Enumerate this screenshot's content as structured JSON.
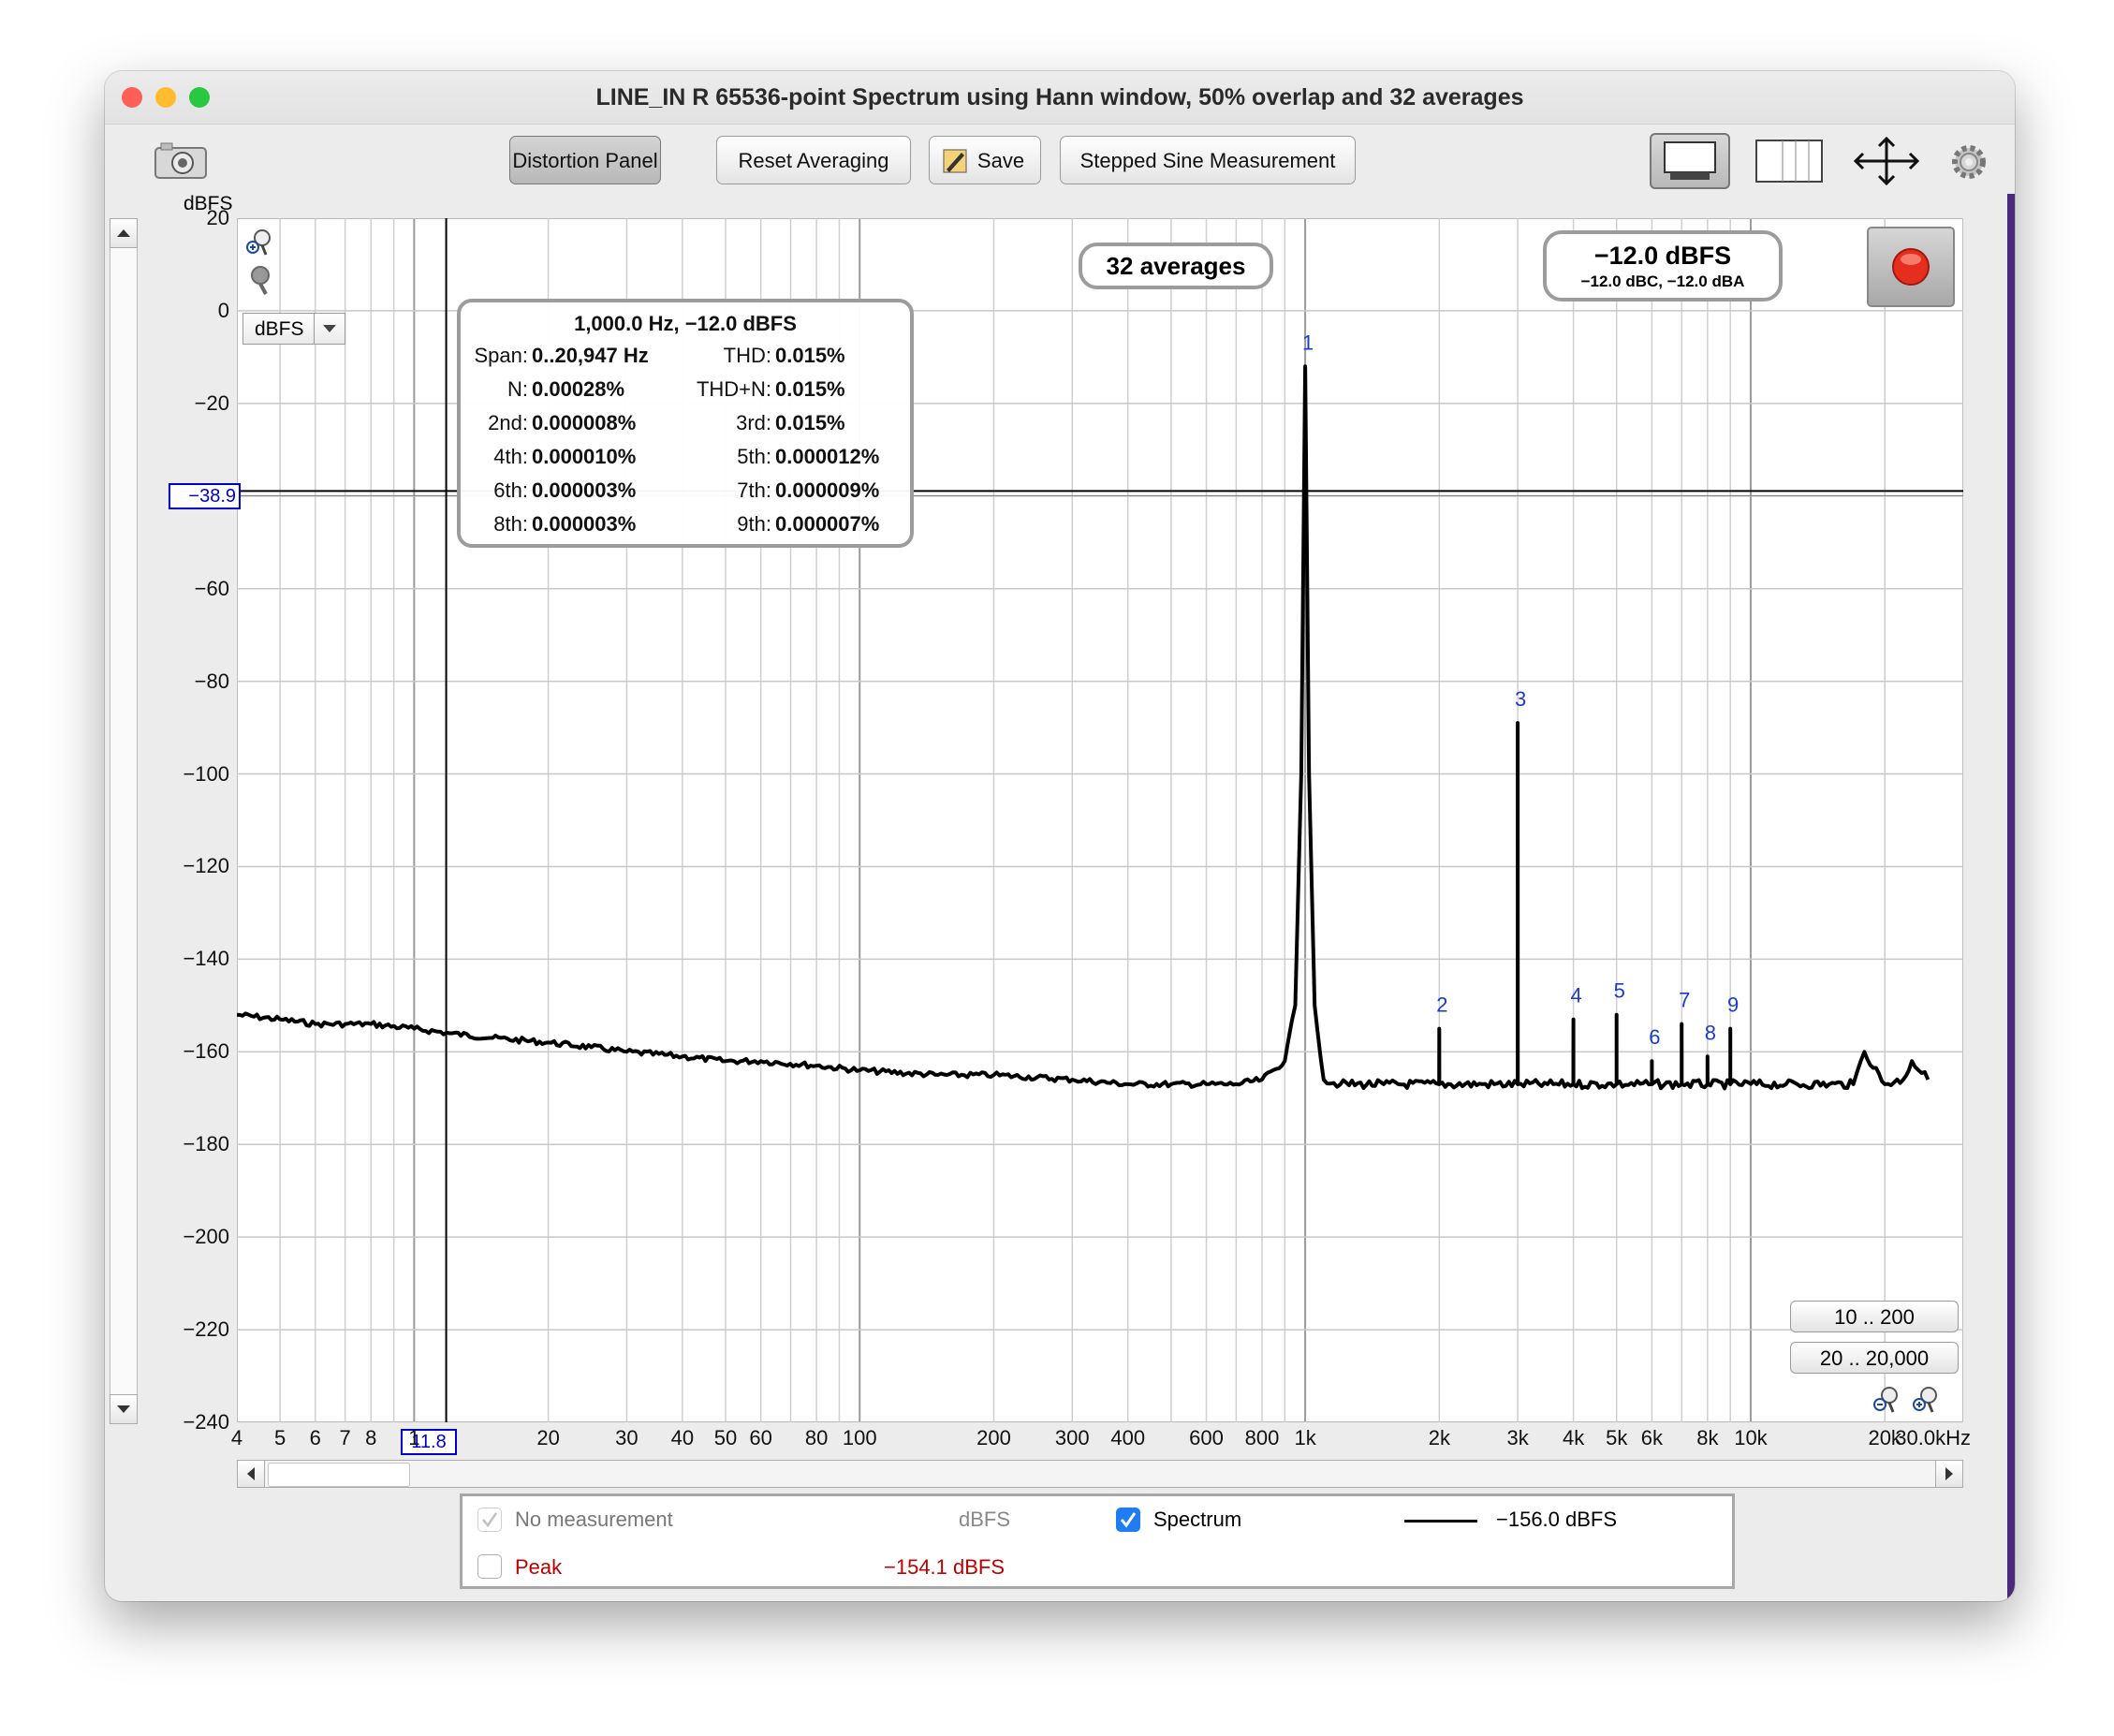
{
  "window": {
    "title": "LINE_IN R 65536-point Spectrum using Hann window, 50% overlap and 32 averages",
    "traffic_lights": {
      "close": "#ff5f57",
      "minimize": "#febc2e",
      "zoom": "#28c840"
    }
  },
  "toolbar": {
    "camera_icon": "camera-icon",
    "distortion_panel": "Distortion Panel",
    "reset_averaging": "Reset Averaging",
    "save": "Save",
    "stepped_sine": "Stepped Sine Measurement",
    "view_icons": [
      "screen-layout-icon",
      "columns-icon",
      "expand-arrows-icon",
      "gear-icon"
    ]
  },
  "distortion_panel": {
    "header": "1,000.0 Hz, −12.0 dBFS",
    "rows": [
      {
        "l1": "Span:",
        "v1": "0..20,947 Hz",
        "l2": "THD:",
        "v2": "0.015%"
      },
      {
        "l1": "N:",
        "v1": "0.00028%",
        "l2": "THD+N:",
        "v2": "0.015%"
      },
      {
        "l1": "2nd:",
        "v1": "0.000008%",
        "l2": "3rd:",
        "v2": "0.015%"
      },
      {
        "l1": "4th:",
        "v1": "0.000010%",
        "l2": "5th:",
        "v2": "0.000012%"
      },
      {
        "l1": "6th:",
        "v1": "0.000003%",
        "l2": "7th:",
        "v2": "0.000009%"
      },
      {
        "l1": "8th:",
        "v1": "0.000003%",
        "l2": "9th:",
        "v2": "0.000007%"
      }
    ]
  },
  "averages_badge": "32 averages",
  "level_display": {
    "main": "−12.0 dBFS",
    "sub": "−12.0 dBC, −12.0 dBA"
  },
  "unit_select": "dBFS",
  "y_unit_label": "dBFS",
  "cursor": {
    "y_value": "−38.9",
    "x_value": "11.8"
  },
  "range_buttons": [
    "10 .. 200",
    "20 .. 20,000"
  ],
  "legend": {
    "no_measurement": "No measurement",
    "no_measurement_unit": "dBFS",
    "spectrum": "Spectrum",
    "spectrum_value": "−156.0 dBFS",
    "peak": "Peak",
    "peak_value": "−154.1 dBFS",
    "peak_color": "#c00000"
  },
  "chart_data": {
    "type": "line",
    "xlabel": "",
    "ylabel": "dBFS",
    "x_scale": "log",
    "xlim": [
      4,
      30000
    ],
    "ylim": [
      -240,
      20
    ],
    "grid": true,
    "x_ticks": [
      {
        "v": 4,
        "l": "4"
      },
      {
        "v": 5,
        "l": "5"
      },
      {
        "v": 6,
        "l": "6"
      },
      {
        "v": 7,
        "l": "7"
      },
      {
        "v": 8,
        "l": "8"
      },
      {
        "v": 10,
        "l": "1"
      },
      {
        "v": 20,
        "l": "20"
      },
      {
        "v": 30,
        "l": "30"
      },
      {
        "v": 40,
        "l": "40"
      },
      {
        "v": 50,
        "l": "50"
      },
      {
        "v": 60,
        "l": "60"
      },
      {
        "v": 80,
        "l": "80"
      },
      {
        "v": 100,
        "l": "100"
      },
      {
        "v": 200,
        "l": "200"
      },
      {
        "v": 300,
        "l": "300"
      },
      {
        "v": 400,
        "l": "400"
      },
      {
        "v": 600,
        "l": "600"
      },
      {
        "v": 800,
        "l": "800"
      },
      {
        "v": 1000,
        "l": "1k"
      },
      {
        "v": 2000,
        "l": "2k"
      },
      {
        "v": 3000,
        "l": "3k"
      },
      {
        "v": 4000,
        "l": "4k"
      },
      {
        "v": 5000,
        "l": "5k"
      },
      {
        "v": 6000,
        "l": "6k"
      },
      {
        "v": 8000,
        "l": "8k"
      },
      {
        "v": 10000,
        "l": "10k"
      },
      {
        "v": 20000,
        "l": "20k"
      },
      {
        "v": 30000,
        "l": "30.0kHz"
      }
    ],
    "y_ticks": [
      20,
      0,
      -20,
      -60,
      -80,
      -100,
      -120,
      -140,
      -160,
      -180,
      -200,
      -220,
      -240
    ],
    "series": [
      {
        "color": "#000000",
        "x": [
          4,
          5,
          6,
          7,
          8,
          10,
          12,
          15,
          20,
          25,
          30,
          40,
          50,
          60,
          80,
          100,
          150,
          200,
          300,
          400,
          500,
          600,
          700,
          800,
          900,
          950,
          980,
          1000,
          1020,
          1050,
          1100,
          1200,
          1500,
          1999,
          2000,
          2001,
          2500,
          2999,
          3000,
          3001,
          3500,
          3999,
          4000,
          4001,
          4999,
          5000,
          5001,
          5999,
          6000,
          6001,
          6999,
          7000,
          7001,
          7999,
          8000,
          8001,
          8999,
          9000,
          9001,
          12000,
          15000,
          17000,
          18000,
          20000,
          22000,
          23000,
          25000
        ],
        "y": [
          -152,
          -153,
          -154,
          -154,
          -154,
          -155,
          -156,
          -157,
          -158,
          -159,
          -160,
          -161,
          -162,
          -162,
          -163,
          -164,
          -165,
          -165,
          -166,
          -167,
          -167,
          -167,
          -167,
          -166,
          -162,
          -150,
          -100,
          -12,
          -100,
          -150,
          -166,
          -167,
          -167,
          -167,
          -155,
          -167,
          -167,
          -167,
          -89,
          -167,
          -167,
          -167,
          -153,
          -167,
          -167,
          -152,
          -167,
          -167,
          -162,
          -167,
          -167,
          -154,
          -167,
          -167,
          -161,
          -167,
          -167,
          -155,
          -167,
          -167,
          -167,
          -167,
          -160,
          -167,
          -166,
          -162,
          -166
        ]
      }
    ],
    "annotations": [
      {
        "x": 1000,
        "y": -12,
        "text": "1"
      },
      {
        "x": 2000,
        "y": -155,
        "text": "2"
      },
      {
        "x": 3000,
        "y": -89,
        "text": "3"
      },
      {
        "x": 4000,
        "y": -153,
        "text": "4"
      },
      {
        "x": 5000,
        "y": -152,
        "text": "5"
      },
      {
        "x": 6000,
        "y": -162,
        "text": "6"
      },
      {
        "x": 7000,
        "y": -154,
        "text": "7"
      },
      {
        "x": 8000,
        "y": -161,
        "text": "8"
      },
      {
        "x": 9000,
        "y": -155,
        "text": "9"
      }
    ],
    "cursor_line_y": -38.9,
    "cursor_line_x": 11.8
  }
}
